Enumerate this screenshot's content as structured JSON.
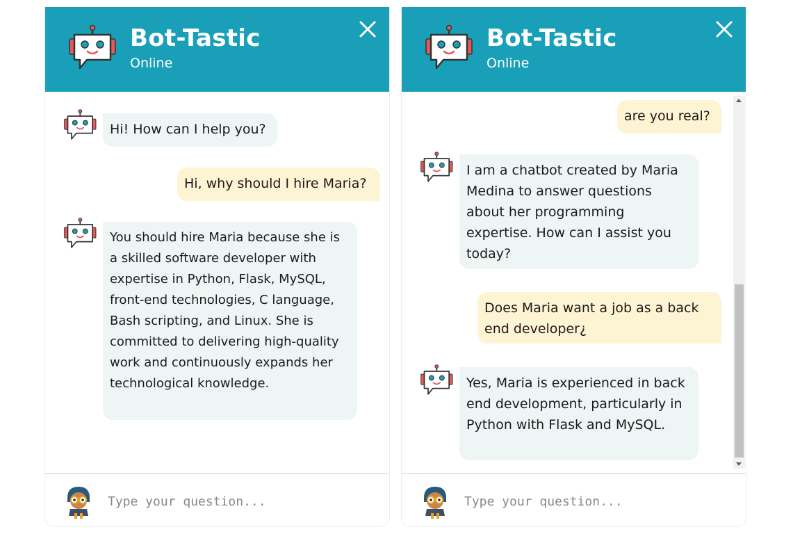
{
  "chatbot": {
    "name": "Bot-Tastic",
    "status": "Online",
    "colors": {
      "header": "#19a0b8",
      "bot_bubble": "#edf5f5",
      "user_bubble": "#fdf4d3"
    }
  },
  "left_panel": {
    "messages": [
      {
        "sender": "bot",
        "text": "Hi! How can I help you?"
      },
      {
        "sender": "user",
        "text": "Hi, why should I hire Maria?"
      },
      {
        "sender": "bot",
        "text": "You should hire Maria because she is a skilled software developer with expertise in Python, Flask, MySQL, front-end technologies, C language, Bash scripting, and Linux. She is committed to delivering high-quality work and continuously expands her technological knowledge."
      }
    ],
    "input_placeholder": "Type your question..."
  },
  "right_panel": {
    "messages": [
      {
        "sender": "user",
        "text": "are you real?"
      },
      {
        "sender": "bot",
        "text": "I am a chatbot created by Maria Medina to answer questions about her programming expertise. How can I assist you today?"
      },
      {
        "sender": "user",
        "text": "Does Maria want a job as a back end developer¿"
      },
      {
        "sender": "bot",
        "text": "Yes, Maria is experienced in back end development, particularly in Python with Flask and MySQL."
      }
    ],
    "input_placeholder": "Type your question..."
  },
  "icons": {
    "header_avatar": "robot-icon",
    "close": "close-icon",
    "bot_avatar": "robot-icon",
    "user_avatar": "user-avatar-icon"
  }
}
